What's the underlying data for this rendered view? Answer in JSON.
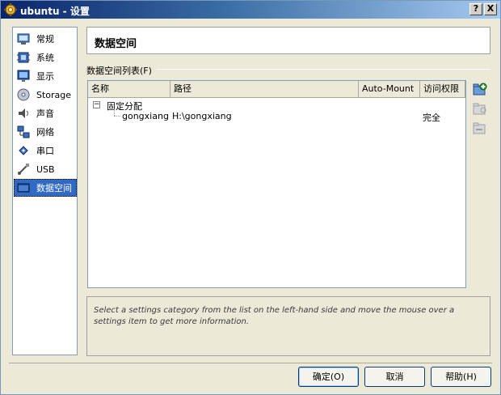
{
  "window": {
    "title": "ubuntu - 设置",
    "help_btn": "?",
    "close_btn": "X"
  },
  "sidebar": {
    "items": [
      {
        "label": "常规",
        "icon": "general-icon",
        "selected": false
      },
      {
        "label": "系统",
        "icon": "system-icon",
        "selected": false
      },
      {
        "label": "显示",
        "icon": "display-icon",
        "selected": false
      },
      {
        "label": "Storage",
        "icon": "storage-icon",
        "selected": false
      },
      {
        "label": "声音",
        "icon": "audio-icon",
        "selected": false
      },
      {
        "label": "网络",
        "icon": "network-icon",
        "selected": false
      },
      {
        "label": "串口",
        "icon": "serial-port-icon",
        "selected": false
      },
      {
        "label": "USB",
        "icon": "usb-icon",
        "selected": false
      },
      {
        "label": "数据空间",
        "icon": "shared-folders-icon",
        "selected": true
      }
    ]
  },
  "header": {
    "title": "数据空间"
  },
  "group": {
    "label": "数据空间列表(F)"
  },
  "tree": {
    "columns": [
      "名称",
      "路径",
      "Auto-Mount",
      "访问权限"
    ],
    "group_node": {
      "expander": "−",
      "label": "固定分配"
    },
    "rows": [
      {
        "name": "gongxiang",
        "path": "H:\\gongxiang",
        "auto_mount": "",
        "access": "完全"
      }
    ]
  },
  "toolbar": {
    "add_icon": "add-folder-icon",
    "edit_icon": "edit-folder-icon",
    "remove_icon": "remove-folder-icon"
  },
  "info": {
    "text": "Select a settings category from the list on the left-hand side and move the mouse over a settings item to get more information."
  },
  "buttons": {
    "ok": "确定(O)",
    "cancel": "取消",
    "help": "帮助(H)"
  },
  "colors": {
    "selection": "#316ac5",
    "title_start": "#0a246a",
    "title_end": "#a6caf0"
  }
}
